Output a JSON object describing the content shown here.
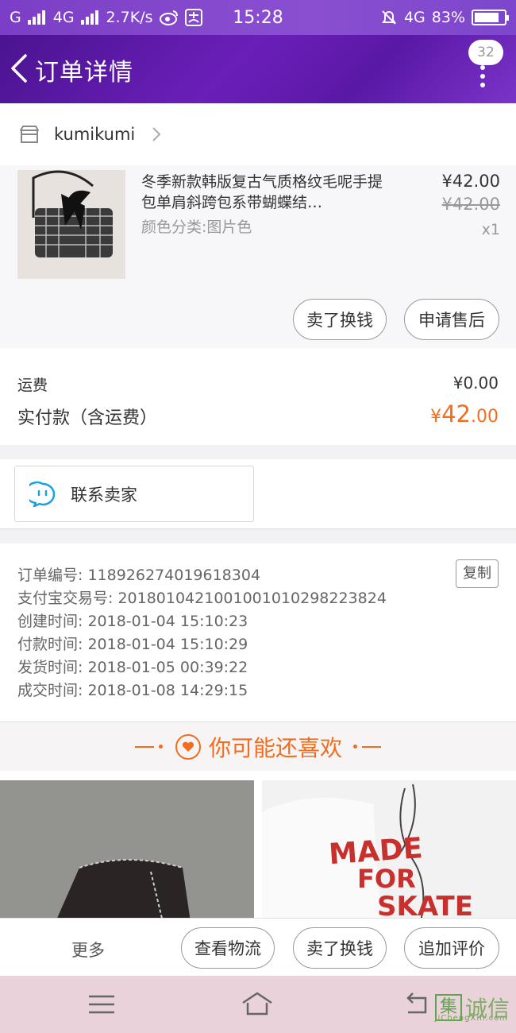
{
  "status_bar": {
    "network_left": "G",
    "network_4g": "4G",
    "speed": "2.7K/s",
    "time": "15:28",
    "network_right": "4G",
    "battery": "83%",
    "battery_level": 0.83
  },
  "header": {
    "title": "订单详情",
    "message_count": "32"
  },
  "shop": {
    "name": "kumikumi"
  },
  "product": {
    "title": "冬季新款韩版复古气质格纹毛呢手提包单肩斜跨包系带蝴蝶结…",
    "sku": "颜色分类:图片色",
    "price": "¥42.00",
    "original_price": "¥42.00",
    "quantity": "x1",
    "actions": [
      "卖了换钱",
      "申请售后"
    ]
  },
  "fees": {
    "shipping_label": "运费",
    "shipping_value": "¥0.00",
    "paid_label": "实付款（含运费）",
    "paid_currency": "¥",
    "paid_integer": "42",
    "paid_decimal": ".00"
  },
  "contact": {
    "label": "联系卖家"
  },
  "order_info": {
    "copy_label": "复制",
    "lines": [
      "订单编号: 118926274019618304",
      "支付宝交易号: 2018010421001001010298223824",
      "创建时间: 2018-01-04 15:10:23",
      "付款时间: 2018-01-04 15:10:29",
      "发货时间: 2018-01-05 00:39:22",
      "成交时间: 2018-01-08 14:29:15"
    ]
  },
  "recommend": {
    "title": "你可能还喜欢",
    "item2_print": [
      "MADE",
      "FOR",
      "SKATE"
    ]
  },
  "bottom_bar": {
    "more": "更多",
    "actions": [
      "查看物流",
      "卖了换钱",
      "追加评价"
    ]
  },
  "watermark": {
    "char_box": "集",
    "text": "诚信",
    "sub": "JiChengXin.com"
  }
}
